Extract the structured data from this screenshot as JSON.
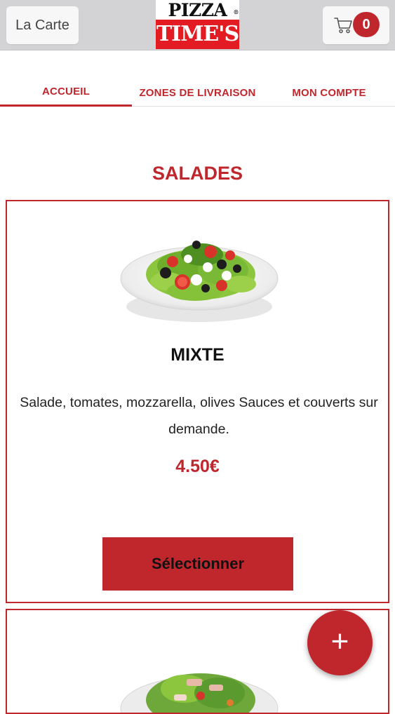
{
  "header": {
    "menu_label": "La Carte",
    "logo_top": "PIZZA",
    "logo_registered": "®",
    "logo_bottom": "TIME'S",
    "cart_count": "0"
  },
  "tabs": [
    {
      "label": "ACCUEIL",
      "active": true
    },
    {
      "label": "ZONES DE LIVRAISON",
      "active": false
    },
    {
      "label": "MON COMPTE",
      "active": false
    }
  ],
  "section": {
    "title": "SALADES"
  },
  "products": [
    {
      "name": "MIXTE",
      "description": "Salade, tomates, mozzarella, olives  Sauces et couverts sur demande.",
      "price": "4.50€",
      "button_label": "Sélectionner"
    }
  ],
  "fab": {
    "label": "+"
  },
  "colors": {
    "accent": "#c0272d",
    "logo_red": "#e31b23",
    "topbar": "#d3d3d5"
  },
  "icons": {
    "cart": "cart-icon",
    "fab": "plus-icon"
  }
}
